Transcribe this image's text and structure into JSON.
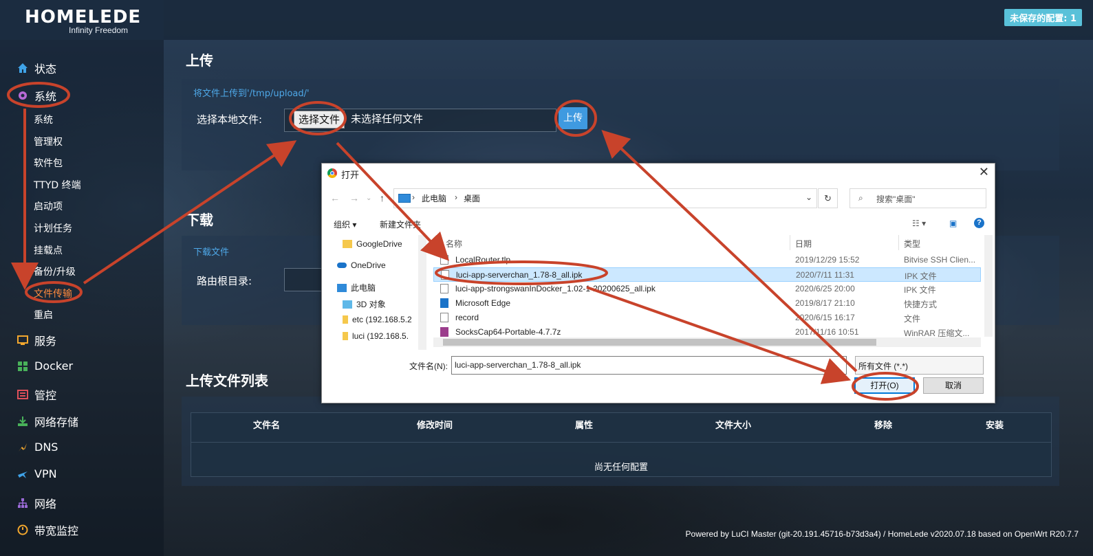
{
  "header": {
    "logo_main": "HOMELEDE",
    "logo_sub": "Infinity Freedom",
    "unsaved_label": "未保存的配置: 1"
  },
  "sidebar": {
    "items": [
      {
        "label": "状态",
        "icon": "home-icon"
      },
      {
        "label": "系统",
        "icon": "gear-icon"
      },
      {
        "label": "服务",
        "icon": "services-icon"
      },
      {
        "label": "Docker",
        "icon": "docker-icon"
      },
      {
        "label": "管控",
        "icon": "control-icon"
      },
      {
        "label": "网络存储",
        "icon": "storage-icon"
      },
      {
        "label": "DNS",
        "icon": "dns-icon"
      },
      {
        "label": "VPN",
        "icon": "vpn-icon"
      },
      {
        "label": "网络",
        "icon": "network-icon"
      },
      {
        "label": "带宽监控",
        "icon": "bandwidth-icon"
      }
    ],
    "system_subitems": [
      "系统",
      "管理权",
      "软件包",
      "TTYD 终端",
      "启动项",
      "计划任务",
      "挂载点",
      "备份/升级",
      "文件传输",
      "重启"
    ],
    "active_subitem": "文件传输"
  },
  "upload": {
    "title": "上传",
    "note": "将文件上传到'/tmp/upload/'",
    "field_label": "选择本地文件:",
    "choose_button": "选择文件",
    "no_file_text": "未选择任何文件",
    "upload_button": "上传"
  },
  "download": {
    "title": "下载",
    "note": "下载文件",
    "field_label": "路由根目录:"
  },
  "file_list": {
    "title": "上传文件列表",
    "columns": [
      "文件名",
      "修改时间",
      "属性",
      "文件大小",
      "移除",
      "安装"
    ],
    "empty_text": "尚无任何配置"
  },
  "footer": "Powered by LuCI Master (git-20.191.45716-b73d3a4) / HomeLede v2020.07.18 based on OpenWrt R20.7.7",
  "dialog": {
    "title": "打开",
    "path": [
      "此电脑",
      "桌面"
    ],
    "search_placeholder": "搜索\"桌面\"",
    "toolbar": {
      "organize": "组织 ▾",
      "new_folder": "新建文件夹"
    },
    "tree": [
      {
        "label": "GoogleDrive",
        "icon": "folder-icon"
      },
      {
        "label": "OneDrive",
        "icon": "cloud-icon"
      },
      {
        "label": "此电脑",
        "icon": "pc-icon"
      },
      {
        "label": "3D 对象",
        "icon": "3d-icon"
      },
      {
        "label": "etc (192.168.5.2",
        "icon": "drive-icon"
      },
      {
        "label": "luci (192.168.5.",
        "icon": "drive-icon"
      }
    ],
    "columns": [
      "名称",
      "日期",
      "类型"
    ],
    "files": [
      {
        "name": "LocalRouter.tlp",
        "date": "2019/12/29 15:52",
        "type": "Bitvise SSH Clien..."
      },
      {
        "name": "luci-app-serverchan_1.78-8_all.ipk",
        "date": "2020/7/11 11:31",
        "type": "IPK 文件"
      },
      {
        "name": "luci-app-strongswanInDocker_1.02-1-20200625_all.ipk",
        "date": "2020/6/25 20:00",
        "type": "IPK 文件"
      },
      {
        "name": "Microsoft Edge",
        "date": "2019/8/17 21:10",
        "type": "快捷方式"
      },
      {
        "name": "record",
        "date": "2020/6/15 16:17",
        "type": "文件"
      },
      {
        "name": "SocksCap64-Portable-4.7.7z",
        "date": "2017/11/16 10:51",
        "type": "WinRAR 压缩文..."
      }
    ],
    "selected_file": "luci-app-serverchan_1.78-8_all.ipk",
    "filename_label": "文件名(N):",
    "filename_value": "luci-app-serverchan_1.78-8_all.ipk",
    "filetype_value": "所有文件 (*.*)",
    "open_button": "打开(O)",
    "cancel_button": "取消"
  },
  "colors": {
    "accent": "#3f9ae0",
    "annotation": "#c8432b",
    "active_menu": "#ff8a3d",
    "badge": "#59c1d9"
  }
}
